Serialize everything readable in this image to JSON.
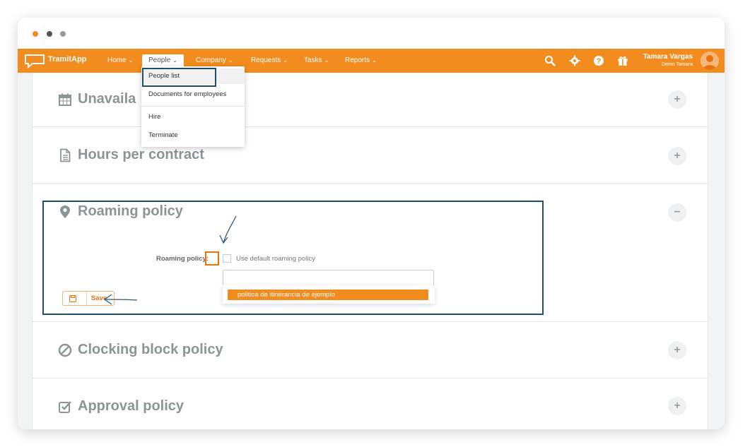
{
  "brand": {
    "logo_text": "TramitApp",
    "accent_color": "#f28c1e"
  },
  "nav": {
    "items": [
      {
        "label": "Home",
        "chevron": "⌄"
      },
      {
        "label": "People",
        "chevron": "⌄"
      },
      {
        "label": "Company",
        "chevron": "⌄"
      },
      {
        "label": "Requests",
        "chevron": "⌄"
      },
      {
        "label": "Tasks",
        "chevron": "⌄"
      },
      {
        "label": "Reports",
        "chevron": "⌄"
      }
    ],
    "icons": [
      "search-icon",
      "gear-icon",
      "help-icon",
      "gift-icon"
    ],
    "user": {
      "name": "Tamara Vargas",
      "company": "Demo Tamara"
    }
  },
  "people_menu": {
    "items": [
      "People list",
      "Documents for employees",
      "Hire",
      "Terminate"
    ]
  },
  "sections": [
    {
      "title": "Unavaila",
      "icon": "calendar-icon",
      "toggle": "+"
    },
    {
      "title": "Hours per contract",
      "icon": "document-icon",
      "toggle": "+"
    },
    {
      "title": "Roaming policy",
      "icon": "map-pin-icon",
      "toggle": "−"
    },
    {
      "title": "Clocking block policy",
      "icon": "ban-icon",
      "toggle": "+"
    },
    {
      "title": "Approval policy",
      "icon": "check-square-icon",
      "toggle": "+"
    }
  ],
  "roaming": {
    "field_label": "Roaming policy:",
    "checkbox_label": "Use default roaming policy",
    "checkbox_checked": false,
    "select_value": "",
    "dropdown_option": "politica de itinerancia de ejemplo",
    "save_label": "Save"
  }
}
